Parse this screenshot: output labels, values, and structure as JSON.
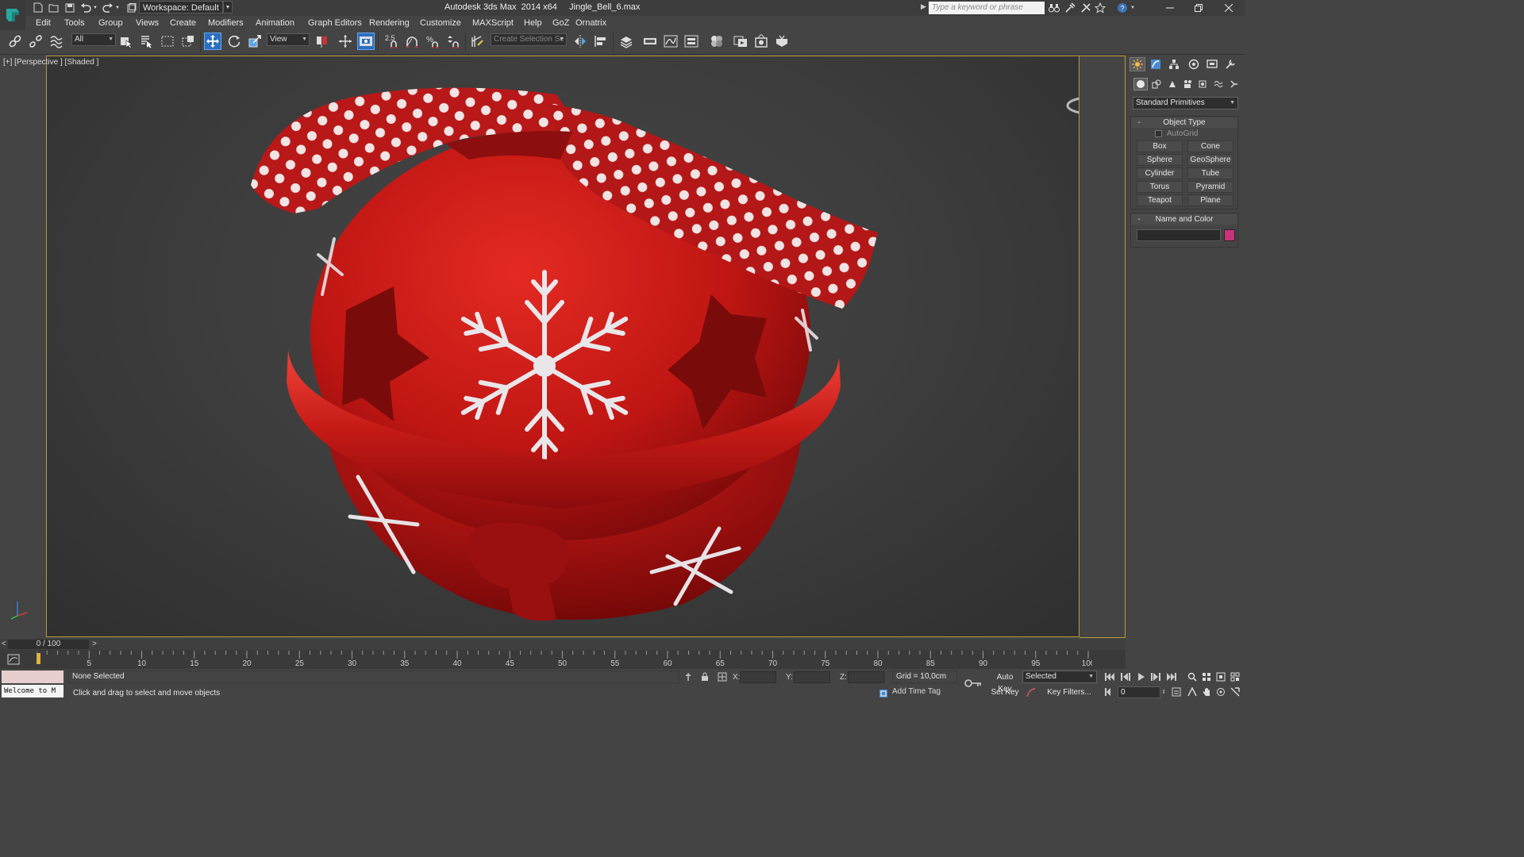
{
  "titlebar": {
    "workspace": "Workspace: Default",
    "title": "Autodesk 3ds Max  2014 x64     Jingle_Bell_6.max",
    "search_placeholder": "Type a keyword or phrase"
  },
  "menu": [
    "Edit",
    "Tools",
    "Group",
    "Views",
    "Create",
    "Modifiers",
    "Animation",
    "Graph Editors",
    "Rendering",
    "Customize",
    "MAXScript",
    "Help",
    "GoZ",
    "Ornatrix"
  ],
  "toolbar": {
    "selection_filter": "All",
    "ref_coord": "View",
    "angle_snap": "2.5",
    "named_selection_placeholder": "Create Selection Se"
  },
  "viewport": {
    "label": "[+] [Perspective ] [Shaded ]"
  },
  "command_panel": {
    "category": "Standard Primitives",
    "object_type_title": "Object Type",
    "autogrid_label": "AutoGrid",
    "buttons": [
      "Box",
      "Cone",
      "Sphere",
      "GeoSphere",
      "Cylinder",
      "Tube",
      "Torus",
      "Pyramid",
      "Teapot",
      "Plane"
    ],
    "name_color_title": "Name and Color",
    "object_color": "#c8337a"
  },
  "timeline": {
    "frame_display": "0 / 100",
    "prev_label": "<",
    "next_label": ">",
    "ticks": [
      "5",
      "10",
      "15",
      "20",
      "25",
      "30",
      "35",
      "40",
      "45",
      "50",
      "55",
      "60",
      "65",
      "70",
      "75",
      "80",
      "85",
      "90",
      "95",
      "100"
    ]
  },
  "status": {
    "maxscript_welcome": "Welcome to M",
    "selection": "None Selected",
    "prompt": "Click and drag to select and move objects",
    "x_label": "X:",
    "y_label": "Y:",
    "z_label": "Z:",
    "grid": "Grid = 10,0cm",
    "add_time_tag": "Add Time Tag",
    "auto_key": "Auto Key",
    "set_key": "Set Key",
    "key_mode": "Selected",
    "key_filters": "Key Filters...",
    "current_frame": "0"
  },
  "colors": {
    "viewport_border": "#b99b3f",
    "active_tool": "#2a6fc0",
    "bell_red": "#c81818"
  }
}
